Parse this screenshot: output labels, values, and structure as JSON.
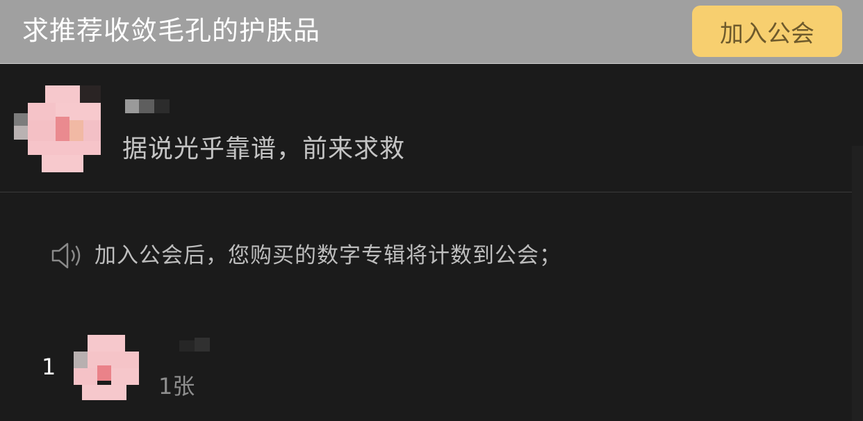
{
  "header": {
    "title": "求推荐收敛毛孔的护肤品",
    "join_button_label": "加入公会"
  },
  "guild": {
    "description": "据说光乎靠谱，前来求救"
  },
  "notice": {
    "icon": "speaker-icon",
    "text": "加入公会后，您购买的数字专辑将计数到公会；"
  },
  "ranking": [
    {
      "rank": "1",
      "count": "1张"
    }
  ],
  "colors": {
    "header_bg": "#a0a0a0",
    "join_button_bg": "#f7cf6f",
    "page_bg": "#1b1b1b"
  }
}
